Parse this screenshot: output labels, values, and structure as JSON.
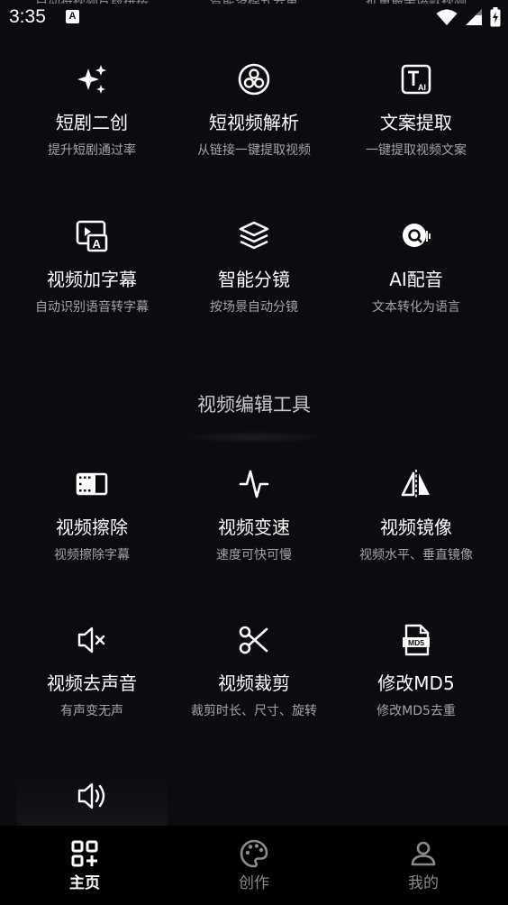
{
  "status_bar": {
    "time": "3:35",
    "app_indicator": "A",
    "icons": [
      "wifi-icon",
      "signal-icon",
      "battery-charging-icon"
    ]
  },
  "ai_tools": [
    {
      "name": "短剧二创",
      "desc": "提升短剧通过率",
      "icon": "sparkles-icon"
    },
    {
      "name": "短视频解析",
      "desc": "从链接一键提取视频",
      "icon": "link-parse-icon"
    },
    {
      "name": "文案提取",
      "desc": "一键提取视频文案",
      "icon": "text-ai-icon"
    },
    {
      "name": "视频加字幕",
      "desc": "自动识别语音转字幕",
      "icon": "subtitle-icon"
    },
    {
      "name": "智能分镜",
      "desc": "按场景自动分镜",
      "icon": "layers-icon"
    },
    {
      "name": "AI配音",
      "desc": "文本转化为语言",
      "icon": "voice-icon"
    }
  ],
  "editing_section": {
    "title": "视频编辑工具",
    "tools": [
      {
        "name": "视频擦除",
        "desc": "视频擦除字幕",
        "icon": "film-erase-icon"
      },
      {
        "name": "视频变速",
        "desc": "速度可快可慢",
        "icon": "pulse-icon"
      },
      {
        "name": "视频镜像",
        "desc": "视频水平、垂直镜像",
        "icon": "mirror-icon"
      },
      {
        "name": "视频去声音",
        "desc": "有声变无声",
        "icon": "mute-icon"
      },
      {
        "name": "视频裁剪",
        "desc": "裁剪时长、尺寸、旋转",
        "icon": "scissors-icon"
      },
      {
        "name": "修改MD5",
        "desc": "修改MD5去重",
        "icon": "md5-file-icon"
      }
    ],
    "partial_tool_icon": "volume-icon"
  },
  "md5_badge": "MD5",
  "bottom_nav": [
    {
      "label": "主页",
      "icon": "grid-plus-icon",
      "active": true
    },
    {
      "label": "创作",
      "icon": "palette-icon",
      "active": false
    },
    {
      "label": "我的",
      "icon": "person-icon",
      "active": false
    }
  ],
  "colors": {
    "background": "#0b0c10",
    "text_primary": "#ffffff",
    "text_secondary": "#a4a4a9",
    "nav_background": "#000000",
    "nav_inactive": "#8a8a8f"
  }
}
